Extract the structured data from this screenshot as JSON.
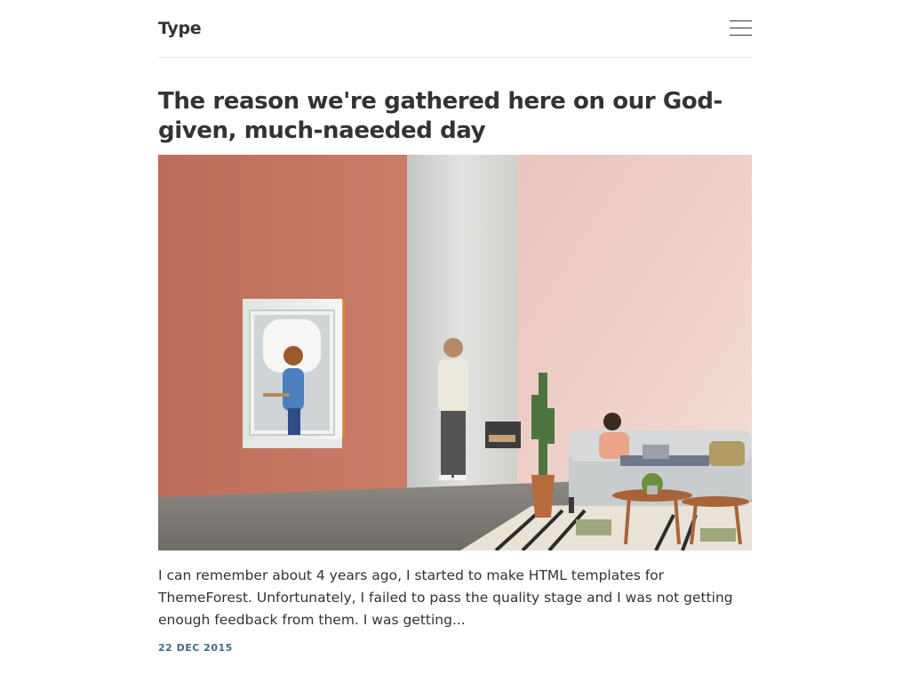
{
  "site": {
    "logo": "Type",
    "accent_color": "#3e6c82"
  },
  "header": {
    "menu_icon": "hamburger-menu-icon"
  },
  "post": {
    "title": "The reason we're gathered here on our God-given, much-naeeded day",
    "image_alt": "Office scene with a phone booth, a man standing and a woman on a sofa",
    "excerpt": "I can remember about 4 years ago, I started to make HTML templates for ThemeForest. Unfortunately, I failed to pass the quality stage and I was not getting enough feedback from them. I was getting...",
    "date": "22 DEC 2015"
  }
}
